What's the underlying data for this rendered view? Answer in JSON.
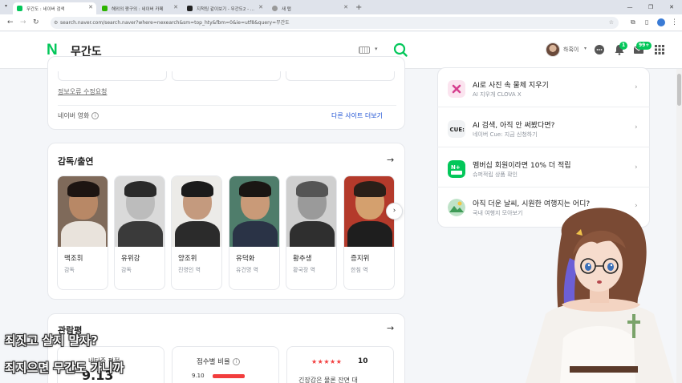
{
  "browser": {
    "tabs": [
      {
        "title": "무간도 : 네이버 검색",
        "active": true,
        "color": "#03c75a"
      },
      {
        "title": "해외의 짱구의 : 네이버 카페",
        "active": false,
        "color": "#2db400"
      },
      {
        "title": "지척팅 같이보기 - 무간도2 - ...",
        "active": false,
        "color": "#222222"
      },
      {
        "title": "새 탭",
        "active": false,
        "color": "#777777"
      }
    ],
    "new_tab": "+",
    "url": "search.naver.com/search.naver?where=nexearch&sm=top_hty&fbm=0&ie=utf8&query=무간도"
  },
  "header": {
    "logo": "N",
    "query": "무간도",
    "user_name": "하혹이",
    "notif_count": "1",
    "mail_count": "99+"
  },
  "main": {
    "edit_link": "정보오류 수정요청",
    "source_label": "네이버 영화",
    "more_sites": "다른 사이트 더보기",
    "cast_section": {
      "title": "감독/출연",
      "people": [
        {
          "name": "맥조휘",
          "role": "감독"
        },
        {
          "name": "유위강",
          "role": "감독"
        },
        {
          "name": "양조위",
          "role": "진영인 역"
        },
        {
          "name": "유덕화",
          "role": "유건명 역"
        },
        {
          "name": "황추생",
          "role": "황국장 역"
        },
        {
          "name": "증지위",
          "role": "한침 역"
        }
      ]
    },
    "review_section": {
      "title": "관람평",
      "score_label": "네티즌 평점",
      "score_value": "9.13",
      "ratio_label": "점수별 비율",
      "ratio_value": "9.10",
      "stars": "★★★★★",
      "star_score": "10",
      "review_snippet": "긴장감은 물론 잔면 대"
    }
  },
  "right_panel": {
    "items": [
      {
        "title": "AI로 사진 속 물체 지우기",
        "sub": "AI 지우개 CLOVA X"
      },
      {
        "title": "AI 검색, 아직 안 써봤다면?",
        "sub": "네이버 Cue: 지금 신청하기"
      },
      {
        "title": "멤버십 회원이라면 10% 더 적립",
        "sub": "슈퍼적립 상품 확인"
      },
      {
        "title": "아직 더운 날씨, 시원한 여행지는 어디?",
        "sub": "국내 여행지 모아보기"
      }
    ]
  },
  "overlay": {
    "subtitle_line1": "죄짓고 살지 말자?",
    "subtitle_line2": "죄지으면 무간도 가니까"
  },
  "colors": {
    "naver_green": "#03c75a",
    "link_blue": "#1a4fd3",
    "star_red": "#f23d3d"
  }
}
